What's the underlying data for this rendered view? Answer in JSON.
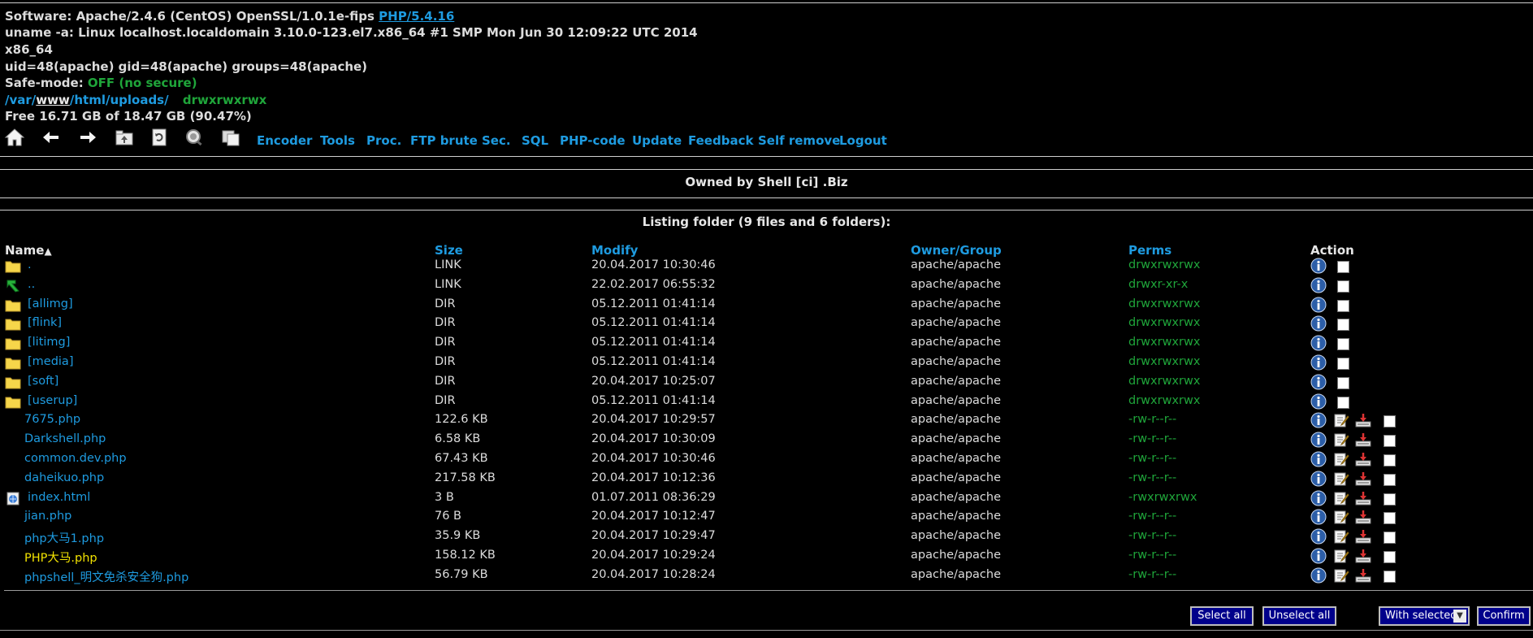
{
  "info": {
    "software_label": "Software: Apache/2.4.6 (CentOS) OpenSSL/1.0.1e-fips ",
    "php_link": "PHP/5.4.16",
    "uname": "uname -a: Linux localhost.localdomain 3.10.0-123.el7.x86_64 #1 SMP Mon Jun 30 12:09:22 UTC 2014",
    "arch": "x86_64",
    "uid": "uid=48(apache) gid=48(apache) groups=48(apache)",
    "safe_mode_label": "Safe-mode: ",
    "safe_mode_value": "OFF (no secure)",
    "path_slash1": "/",
    "path_var": "var",
    "path_slash2": "/",
    "path_www": "www",
    "path_slash3": "/",
    "path_html": "html",
    "path_slash4": "/",
    "path_uploads": "uploads",
    "path_slash5": "/",
    "path_perms": "drwxrwxrwx",
    "free": "Free 16.71 GB of 18.47 GB (90.47%)"
  },
  "toolbar": {
    "icons": [
      "home-icon",
      "back-arrow-icon",
      "forward-arrow-icon",
      "parent-folder-icon",
      "refresh-icon",
      "search-icon",
      "copy-icon"
    ],
    "links": [
      "Encoder",
      "Tools",
      "Proc.",
      "FTP brute",
      "Sec.",
      "SQL",
      "PHP-code",
      "Update",
      "Feedback",
      "Self remove",
      "Logout"
    ]
  },
  "owner_banner": "Owned by Shell [ci] .Biz",
  "listing_title": "Listing folder (9 files and 6 folders):",
  "columns": {
    "name": "Name",
    "sort_indicator": "▲",
    "size": "Size",
    "modify": "Modify",
    "owner": "Owner/Group",
    "perms": "Perms",
    "action": "Action"
  },
  "rows": [
    {
      "icon": "folder-icon",
      "name": ".",
      "size": "LINK",
      "modify": "20.04.2017 10:30:46",
      "owner": "apache/apache",
      "perms": "drwxrwxrwx",
      "type": "dir"
    },
    {
      "icon": "up-arrow-icon",
      "name": "..",
      "size": "LINK",
      "modify": "22.02.2017 06:55:32",
      "owner": "apache/apache",
      "perms": "drwxr-xr-x",
      "type": "dir"
    },
    {
      "icon": "folder-icon",
      "name": "[allimg]",
      "size": "DIR",
      "modify": "05.12.2011 01:41:14",
      "owner": "apache/apache",
      "perms": "drwxrwxrwx",
      "type": "dir"
    },
    {
      "icon": "folder-icon",
      "name": "[flink]",
      "size": "DIR",
      "modify": "05.12.2011 01:41:14",
      "owner": "apache/apache",
      "perms": "drwxrwxrwx",
      "type": "dir"
    },
    {
      "icon": "folder-icon",
      "name": "[litimg]",
      "size": "DIR",
      "modify": "05.12.2011 01:41:14",
      "owner": "apache/apache",
      "perms": "drwxrwxrwx",
      "type": "dir"
    },
    {
      "icon": "folder-icon",
      "name": "[media]",
      "size": "DIR",
      "modify": "05.12.2011 01:41:14",
      "owner": "apache/apache",
      "perms": "drwxrwxrwx",
      "type": "dir"
    },
    {
      "icon": "folder-icon",
      "name": "[soft]",
      "size": "DIR",
      "modify": "20.04.2017 10:25:07",
      "owner": "apache/apache",
      "perms": "drwxrwxrwx",
      "type": "dir"
    },
    {
      "icon": "folder-icon",
      "name": "[userup]",
      "size": "DIR",
      "modify": "05.12.2011 01:41:14",
      "owner": "apache/apache",
      "perms": "drwxrwxrwx",
      "type": "dir"
    },
    {
      "icon": "",
      "name": "7675.php",
      "size": "122.6 KB",
      "modify": "20.04.2017 10:29:57",
      "owner": "apache/apache",
      "perms": "-rw-r--r--",
      "type": "file"
    },
    {
      "icon": "",
      "name": "Darkshell.php",
      "size": "6.58 KB",
      "modify": "20.04.2017 10:30:09",
      "owner": "apache/apache",
      "perms": "-rw-r--r--",
      "type": "file"
    },
    {
      "icon": "",
      "name": "common.dev.php",
      "size": "67.43 KB",
      "modify": "20.04.2017 10:30:46",
      "owner": "apache/apache",
      "perms": "-rw-r--r--",
      "type": "file"
    },
    {
      "icon": "",
      "name": "daheikuo.php",
      "size": "217.58 KB",
      "modify": "20.04.2017 10:12:36",
      "owner": "apache/apache",
      "perms": "-rw-r--r--",
      "type": "file"
    },
    {
      "icon": "html-file-icon",
      "name": "index.html",
      "size": "3 B",
      "modify": "01.07.2011 08:36:29",
      "owner": "apache/apache",
      "perms": "-rwxrwxrwx",
      "type": "file"
    },
    {
      "icon": "",
      "name": "jian.php",
      "size": "76 B",
      "modify": "20.04.2017 10:12:47",
      "owner": "apache/apache",
      "perms": "-rw-r--r--",
      "type": "file"
    },
    {
      "icon": "",
      "name": "php大马1.php",
      "size": "35.9 KB",
      "modify": "20.04.2017 10:29:47",
      "owner": "apache/apache",
      "perms": "-rw-r--r--",
      "type": "file"
    },
    {
      "icon": "",
      "name": "PHP大马.php",
      "size": "158.12 KB",
      "modify": "20.04.2017 10:29:24",
      "owner": "apache/apache",
      "perms": "-rw-r--r--",
      "type": "file",
      "highlight": true
    },
    {
      "icon": "",
      "name": "phpshell_明文免杀安全狗.php",
      "size": "56.79 KB",
      "modify": "20.04.2017 10:28:24",
      "owner": "apache/apache",
      "perms": "-rw-r--r--",
      "type": "file"
    }
  ],
  "footer": {
    "select_all": "Select all",
    "unselect_all": "Unselect all",
    "with_selected": "With selected:",
    "confirm": "Confirm"
  },
  "colors": {
    "link": "#1e9be0",
    "perm_green": "#1fa53a",
    "highlight_yellow": "#f2e200",
    "button_bg": "#00008b"
  }
}
